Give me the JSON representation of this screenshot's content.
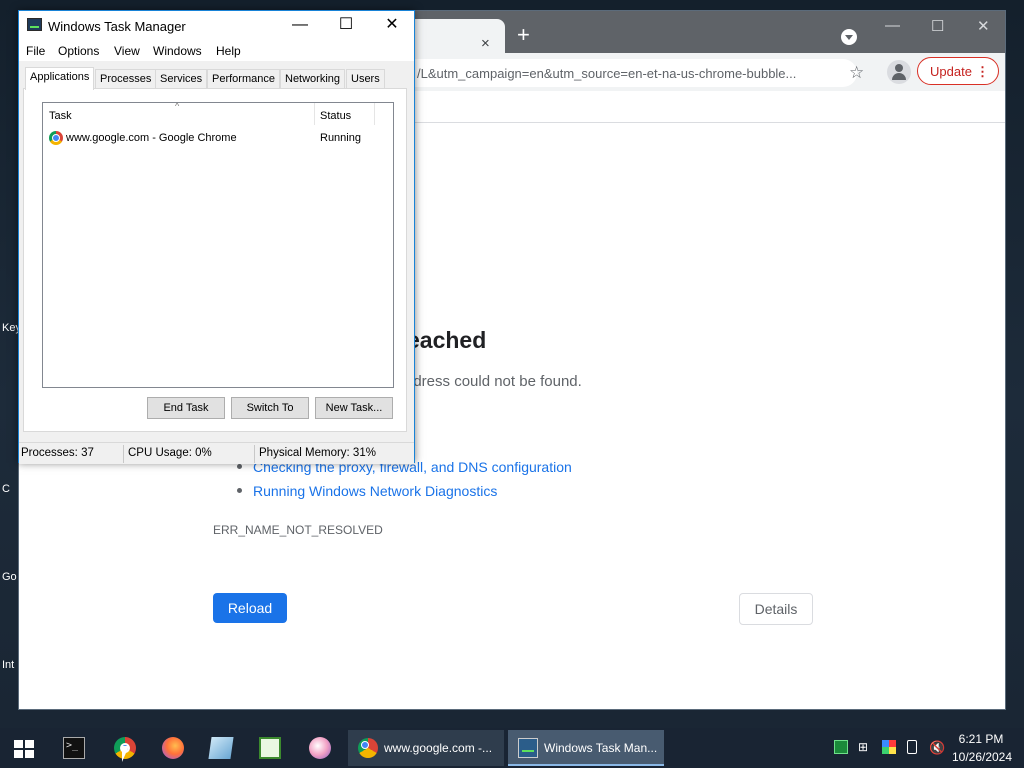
{
  "desktop": {
    "labels": [
      "Key",
      "C",
      "Go",
      "Int"
    ]
  },
  "chrome": {
    "tab_close": "×",
    "new_tab": "+",
    "url": "/L&utm_campaign=en&utm_source=en-et-na-us-chrome-bubble...",
    "update_label": "Update",
    "error_heading": "eached",
    "error_sub": "ddress could not be found.",
    "suggestions": [
      "Checking the proxy, firewall, and DNS configuration",
      "Running Windows Network Diagnostics"
    ],
    "error_code": "ERR_NAME_NOT_RESOLVED",
    "reload_label": "Reload",
    "details_label": "Details",
    "colors": {
      "accent": "#1a73e8",
      "update": "#d93025"
    }
  },
  "task_manager": {
    "title": "Windows Task Manager",
    "menu": [
      "File",
      "Options",
      "View",
      "Windows",
      "Help"
    ],
    "tabs": [
      "Applications",
      "Processes",
      "Services",
      "Performance",
      "Networking",
      "Users"
    ],
    "active_tab": "Applications",
    "columns": {
      "task": "Task",
      "status": "Status"
    },
    "rows": [
      {
        "icon": "chrome-icon",
        "task": "www.google.com - Google Chrome",
        "status": "Running"
      }
    ],
    "buttons": {
      "end_task": "End Task",
      "switch_to": "Switch To",
      "new_task": "New Task..."
    },
    "status_bar": {
      "processes": "Processes: 37",
      "cpu": "CPU Usage: 0%",
      "memory": "Physical Memory: 31%"
    }
  },
  "taskbar": {
    "tasks": [
      {
        "icon": "chrome-icon",
        "label": "www.google.com -..."
      },
      {
        "icon": "task-manager-icon",
        "label": "Windows Task Man..."
      }
    ],
    "clock": {
      "time": "6:21 PM",
      "date": "10/26/2024"
    }
  }
}
